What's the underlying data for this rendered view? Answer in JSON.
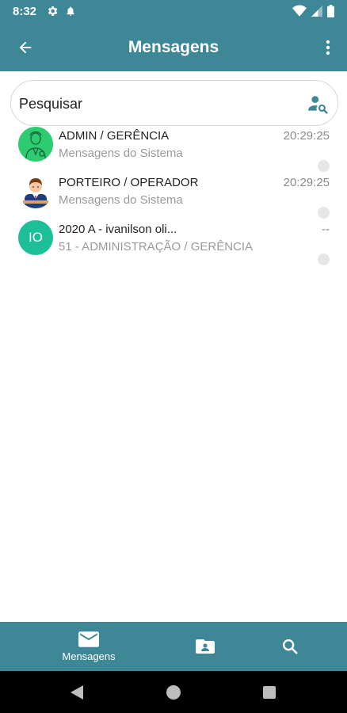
{
  "status_bar": {
    "time": "8:32"
  },
  "app_bar": {
    "title": "Mensagens"
  },
  "search": {
    "placeholder": "Pesquisar"
  },
  "conversations": [
    {
      "name": "ADMIN / GERÊNCIA",
      "subtitle": "Mensagens do Sistema",
      "time": "20:29:25",
      "avatar": "admin-avatar-icon"
    },
    {
      "name": "PORTEIRO / OPERADOR",
      "subtitle": "Mensagens do Sistema",
      "time": "20:29:25",
      "avatar": "porter-avatar-icon"
    },
    {
      "name": "2020 A - ivanilson oli...",
      "subtitle": "51 - ADMINISTRAÇÃO / GERÊNCIA",
      "time": "--",
      "initials": "IO",
      "avatar_color": "#1dbf96"
    }
  ],
  "bottom_nav": {
    "messages_label": "Mensagens"
  },
  "colors": {
    "primary": "#3e8797",
    "avatar_green": "#1dbf96",
    "admin_avatar": "#2ecc71"
  }
}
